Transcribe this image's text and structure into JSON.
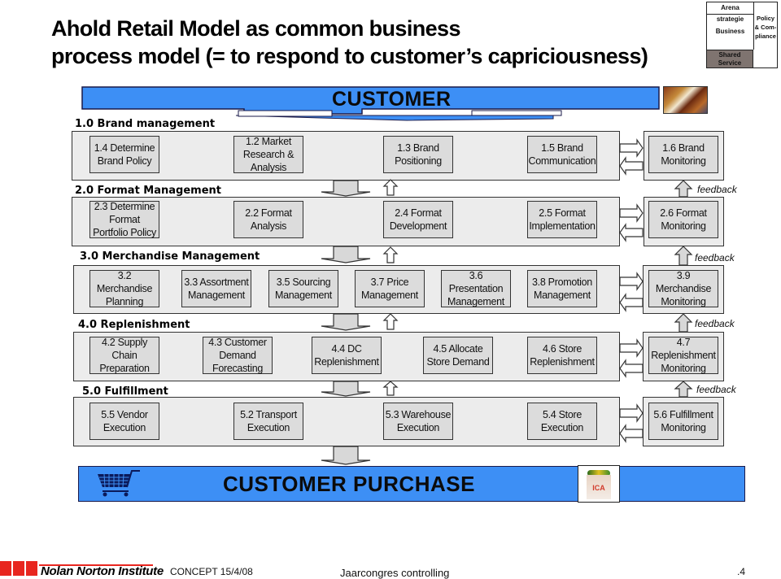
{
  "title": {
    "line1": "Ahold Retail Model as common business",
    "line2": "process model (= to respond to customer’s capriciousness)"
  },
  "arena": {
    "header": "Arena strategie",
    "business": "Business",
    "shared_service": "Shared Service",
    "policy": "Policy & Com- pliance",
    "shared_color": "#7f7470"
  },
  "colors": {
    "banner_blue": "#3d8ff5",
    "panel_gray": "#ececec",
    "box_gray": "#dcdcdc",
    "logo_red": "#e8261f"
  },
  "customer_banner": {
    "label": "CUSTOMER",
    "image": "market-photo"
  },
  "sections": [
    {
      "label": "1.0 Brand management",
      "boxes": [
        "1.4 Determine Brand Policy",
        "1.2 Market Research & Analysis",
        "1.3 Brand Positioning",
        "1.5 Brand Communication"
      ],
      "monitor": "1.6 Brand Monitoring"
    },
    {
      "label": "2.0 Format Management",
      "boxes": [
        "2.3 Determine Format Portfolio Policy",
        "2.2 Format Analysis",
        "2.4 Format Development",
        "2.5 Format Implementation"
      ],
      "monitor": "2.6 Format Monitoring",
      "feedback": "feedback"
    },
    {
      "label": "3.0 Merchandise Management",
      "boxes": [
        "3.2 Merchandise Planning",
        "3.3 Assortment Management",
        "3.5 Sourcing Management",
        "3.7 Price Management",
        "3.6 Presentation Management",
        "3.8 Promotion Management"
      ],
      "monitor": "3.9 Merchandise Monitoring",
      "feedback": "feedback"
    },
    {
      "label": "4.0 Replenishment",
      "boxes": [
        "4.2 Supply Chain Preparation",
        "4.3 Customer Demand Forecasting",
        "4.4 DC Replenishment",
        "4.5 Allocate Store Demand",
        "4.6 Store Replenishment"
      ],
      "monitor": "4.7 Replenishment Monitoring",
      "feedback": "feedback"
    },
    {
      "label": "5.0 Fulfillment",
      "boxes": [
        "5.5 Vendor Execution",
        "5.2 Transport Execution",
        "5.3 Warehouse Execution",
        "5.4 Store Execution"
      ],
      "monitor": "5.6 Fulfillment Monitoring",
      "feedback": "feedback"
    }
  ],
  "purchase_banner": {
    "label": "CUSTOMER PURCHASE",
    "left_icon": "shopping-cart",
    "right_image": "grocery-bag-ica",
    "bag_text": "ICA"
  },
  "footer": {
    "logo": "Nolan Norton Institute",
    "concept": "CONCEPT 15/4/08",
    "event": "Jaarcongres controlling",
    "page": ".4"
  }
}
